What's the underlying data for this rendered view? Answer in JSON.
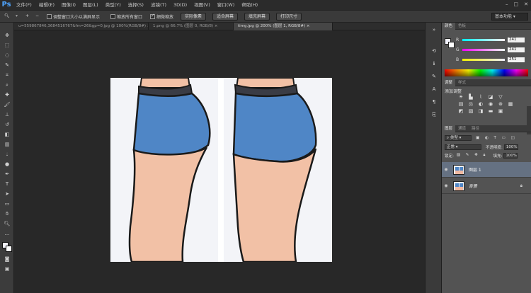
{
  "app": {
    "logo": "Ps"
  },
  "menu": [
    "文件(F)",
    "编辑(E)",
    "图像(I)",
    "图层(L)",
    "类型(Y)",
    "选择(S)",
    "滤镜(T)",
    "3D(D)",
    "视图(V)",
    "窗口(W)",
    "帮助(H)"
  ],
  "window_controls": [
    "–",
    "□",
    "✕"
  ],
  "options": {
    "zoom_in": "+",
    "zoom_out": "−",
    "resize_windows": "调整窗口大小以满屏显示",
    "zoom_all": "缩放所有窗口",
    "scrubby_zoom": "细微缩放",
    "btn_actual": "实际像素",
    "btn_fit": "适合屏幕",
    "btn_fill": "填充屏幕",
    "btn_print": "打印尺寸",
    "workspace": "基本功能"
  },
  "tabs": [
    {
      "label": "u=559867846,3684516767&fm=26&gp=0.jpg @ 100%(RGB/8#) ×",
      "active": false
    },
    {
      "label": "1.png @ 66.7% (图层 0, RGB/8) ×",
      "active": false
    },
    {
      "label": "timg.jpg @ 200% (图层 1, RGB/8#) ×",
      "active": true
    }
  ],
  "color_panel": {
    "tabs": [
      "颜色",
      "色板"
    ],
    "r_label": "R",
    "g_label": "G",
    "b_label": "B",
    "r": "241",
    "g": "241",
    "b": "251"
  },
  "adjust_panel": {
    "tabs": [
      "调整",
      "样式"
    ],
    "title": "添加调整"
  },
  "layers_panel": {
    "tabs": [
      "图层",
      "通道",
      "路径"
    ],
    "kind": "类型",
    "blend": "正常",
    "opacity_label": "不透明度:",
    "opacity": "100%",
    "lock_label": "锁定:",
    "fill_label": "填充:",
    "fill": "100%",
    "layers": [
      {
        "name": "图层 1",
        "selected": true
      },
      {
        "name": "背景",
        "selected": false
      }
    ]
  }
}
